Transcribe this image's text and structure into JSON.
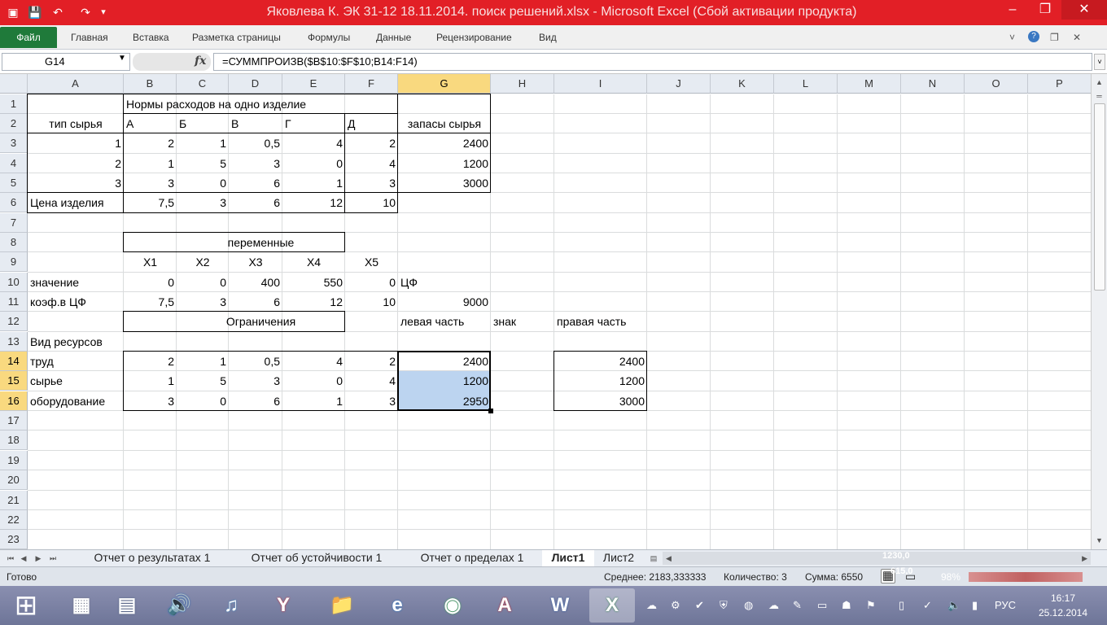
{
  "window": {
    "title": "Яковлева К. ЭК 31-12 18.11.2014. поиск решений.xlsx  -  Microsoft Excel (Сбой активации продукта)",
    "minimize": "–",
    "maximize": "❐",
    "close": "✕"
  },
  "quick_access": {
    "save": "💾",
    "undo": "↶",
    "redo": "↷",
    "customize": "▾"
  },
  "ribbon": {
    "file": "Файл",
    "tabs": [
      "Главная",
      "Вставка",
      "Разметка страницы",
      "Формулы",
      "Данные",
      "Рецензирование",
      "Вид"
    ],
    "icons": {
      "collapse": "˅",
      "help": "?",
      "restore": "❐",
      "close": "✕"
    }
  },
  "formula_bar": {
    "name_box": "G14",
    "fx": "fx",
    "formula": "=СУММПРОИЗВ($B$10:$F$10;B14:F14)"
  },
  "columns": [
    "A",
    "B",
    "C",
    "D",
    "E",
    "F",
    "G",
    "H",
    "I",
    "J",
    "K",
    "L",
    "M",
    "N",
    "O",
    "P"
  ],
  "rows": [
    "1",
    "2",
    "3",
    "4",
    "5",
    "6",
    "7",
    "8",
    "9",
    "10",
    "11",
    "12",
    "13",
    "14",
    "15",
    "16",
    "17",
    "18",
    "19",
    "20",
    "21",
    "22",
    "23"
  ],
  "cells": {
    "B1": "Нормы расходов на одно изделие",
    "A2": "тип сырья",
    "B2": "А",
    "C2": "Б",
    "D2": "В",
    "E2": "Г",
    "F2": "Д",
    "G2": "запасы сырья",
    "A3": "1",
    "B3": "2",
    "C3": "1",
    "D3": "0,5",
    "E3": "4",
    "F3": "2",
    "G3": "2400",
    "A4": "2",
    "B4": "1",
    "C4": "5",
    "D4": "3",
    "E4": "0",
    "F4": "4",
    "G4": "1200",
    "A5": "3",
    "B5": "3",
    "C5": "0",
    "D5": "6",
    "E5": "1",
    "F5": "3",
    "G5": "3000",
    "A6": "Цена изделия",
    "B6": "7,5",
    "C6": "3",
    "D6": "6",
    "E6": "12",
    "F6": "10",
    "B8": "переменные",
    "B9": "X1",
    "C9": "X2",
    "D9": "X3",
    "E9": "X4",
    "F9": "X5",
    "A10": "значение",
    "B10": "0",
    "C10": "0",
    "D10": "400",
    "E10": "550",
    "F10": "0",
    "G10": "ЦФ",
    "A11": "коэф.в ЦФ",
    "B11": "7,5",
    "C11": "3",
    "D11": "6",
    "E11": "12",
    "F11": "10",
    "G11": "9000",
    "B12": "Ограничения",
    "G12": "левая часть",
    "H12": "знак",
    "I12": "правая часть",
    "A13": "Вид ресурсов",
    "A14": "труд",
    "B14": "2",
    "C14": "1",
    "D14": "0,5",
    "E14": "4",
    "F14": "2",
    "G14": "2400",
    "I14": "2400",
    "A15": "сырье",
    "B15": "1",
    "C15": "5",
    "D15": "3",
    "E15": "0",
    "F15": "4",
    "G15": "1200",
    "I15": "1200",
    "A16": "оборудование",
    "B16": "3",
    "C16": "0",
    "D16": "6",
    "E16": "1",
    "F16": "3",
    "G16": "2950",
    "I16": "3000"
  },
  "sheet_tabs": [
    "Отчет о результатах 1",
    "Отчет об устойчивости 1",
    "Отчет о пределах 1",
    "Лист1",
    "Лист2"
  ],
  "active_sheet": "Лист1",
  "sheet_nav": [
    "⏮",
    "◀",
    "▶",
    "⏭"
  ],
  "status": {
    "ready": "Готово",
    "average": "Среднее: 2183,333333",
    "count": "Количество: 3",
    "sum": "Сумма: 6550",
    "zoom": "98%"
  },
  "overlay_values": [
    "1230,0",
    "615,0"
  ],
  "taskbar": {
    "start": "⊞",
    "apps": [
      {
        "name": "explorer-blocks",
        "glyph": "▦",
        "color": "#6a6e80"
      },
      {
        "name": "calculator",
        "glyph": "▤",
        "color": "#4a5a7a"
      },
      {
        "name": "audio",
        "glyph": "🔊",
        "color": "#2c6ab8"
      },
      {
        "name": "music",
        "glyph": "♫",
        "color": "#3a8fd0"
      },
      {
        "name": "yandex-browser",
        "glyph": "Y",
        "color": "#d8202a"
      },
      {
        "name": "folder",
        "glyph": "📁",
        "color": "#e0b040"
      },
      {
        "name": "internet-explorer",
        "glyph": "e",
        "color": "#1e73c8"
      },
      {
        "name": "chrome",
        "glyph": "◉",
        "color": "#2e9e48"
      },
      {
        "name": "acrobat",
        "glyph": "A",
        "color": "#c8181e"
      },
      {
        "name": "word",
        "glyph": "W",
        "color": "#1e4e9a"
      },
      {
        "name": "excel",
        "glyph": "X",
        "color": "#1f7a3a"
      }
    ],
    "tray_icons": [
      "☁",
      "⚙",
      "✔",
      "⛨",
      "◍",
      "☁",
      "✎",
      "▭",
      "☗",
      "⚑",
      "▯",
      "✓",
      "🔈",
      "▮"
    ],
    "lang": "РУС",
    "time": "16:17",
    "date": "25.12.2014"
  }
}
